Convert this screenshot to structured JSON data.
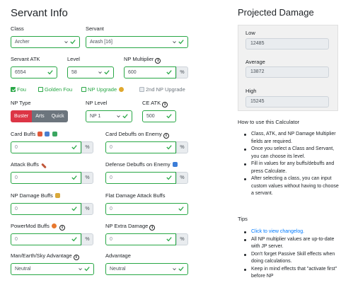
{
  "servant_info": {
    "title": "Servant Info",
    "class_label": "Class",
    "class_value": "Archer",
    "servant_label": "Servant",
    "servant_value": "Arash [16]",
    "atk_label": "Servant ATK",
    "atk_value": "6554",
    "level_label": "Level",
    "level_value": "58",
    "np_mult_label": "NP Multiplier",
    "np_mult_value": "600",
    "pct": "%",
    "checkboxes": [
      {
        "label": "Fou",
        "checked": true
      },
      {
        "label": "Golden Fou",
        "checked": false
      },
      {
        "label": "NP Upgrade",
        "checked": false
      },
      {
        "label": "2nd NP Upgrade",
        "checked": false,
        "disabled": true
      }
    ],
    "np_type_label": "NP Type",
    "np_types": [
      "Buster",
      "Arts",
      "Quick"
    ],
    "np_level_label": "NP Level",
    "np_level_value": "NP 1",
    "ce_atk_label": "CE ATK",
    "ce_atk_value": "500",
    "card_buffs_label": "Card Buffs",
    "card_buffs_value": "0",
    "card_debuffs_label": "Card Debuffs on Enemy",
    "card_debuffs_value": "0",
    "attack_buffs_label": "Attack Buffs",
    "attack_buffs_value": "0",
    "def_debuffs_label": "Defense Debuffs on Enemy",
    "def_debuffs_value": "0",
    "np_dmg_buffs_label": "NP Damage Buffs",
    "np_dmg_buffs_value": "0",
    "flat_dmg_label": "Flat Damage Attack Buffs",
    "flat_dmg_value": "0",
    "powermod_label": "PowerMod Buffs",
    "powermod_value": "0",
    "np_extra_label": "NP Extra Damage",
    "np_extra_value": "0",
    "mes_label": "Man/Earth/Sky Advantage",
    "mes_value": "Neutral",
    "advantage_label": "Advantage",
    "advantage_value": "Neutral"
  },
  "projected": {
    "title": "Projected Damage",
    "low_label": "Low",
    "low_value": "12485",
    "avg_label": "Average",
    "avg_value": "13872",
    "high_label": "High",
    "high_value": "15245"
  },
  "howto": {
    "title": "How to use this Calculator",
    "items": [
      "Class, ATK, and NP Damage Multiplier fields are required.",
      "Once you select a Class and Servant, you can choose its level.",
      "Fill in values for any buffs/debuffs and press Calculate.",
      "After selecting a class, you can input custom values without having to choose a servant."
    ]
  },
  "tips": {
    "title": "Tips",
    "items": [
      "Click to view changelog.",
      "All NP multiplier values are up-to-date with JP server.",
      "Don't forget Passive Skill effects when doing calculations.",
      "Keep in mind effects that \"activate first\" before NP"
    ]
  },
  "colors": {
    "valid": "#28a745",
    "buster": "#dc3545",
    "secondary": "#6c757d",
    "link": "#007bff"
  }
}
